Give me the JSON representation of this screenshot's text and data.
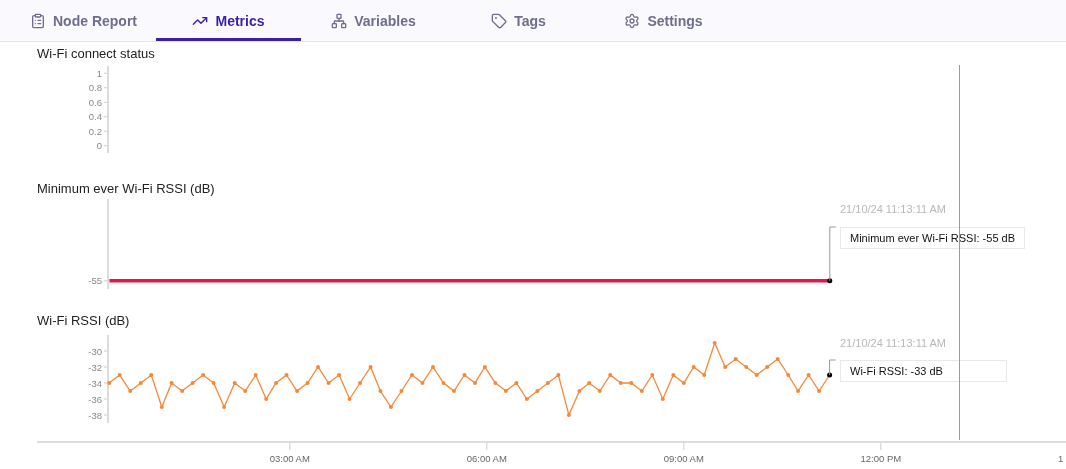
{
  "tabs": [
    {
      "label": "Node Report",
      "selected": false
    },
    {
      "label": "Metrics",
      "selected": true
    },
    {
      "label": "Variables",
      "selected": false
    },
    {
      "label": "Tags",
      "selected": false
    },
    {
      "label": "Settings",
      "selected": false
    }
  ],
  "charts": [
    {
      "title": "Wi-Fi connect status",
      "y_ticks": [
        "1",
        "0.8",
        "0.6",
        "0.4",
        "0.2",
        "0"
      ]
    },
    {
      "title": "Minimum ever Wi-Fi RSSI (dB)",
      "y_ticks": [
        "-55"
      ],
      "tooltip": {
        "time": "21/10/24 11:13:11 AM",
        "text": "Minimum ever Wi-Fi RSSI: -55 dB"
      }
    },
    {
      "title": "Wi-Fi RSSI (dB)",
      "chart_data": {
        "type": "line",
        "xlim": [
          -0.85,
          14.82
        ],
        "ylim": [
          -39,
          -28
        ],
        "yticks": [
          -38,
          -36,
          -34,
          -32,
          -30
        ],
        "xticks": [
          {
            "value": 3,
            "label": "03:00 AM"
          },
          {
            "value": 6,
            "label": "06:00 AM"
          },
          {
            "value": 9,
            "label": "09:00 AM"
          },
          {
            "value": 12,
            "label": "12:00 PM"
          }
        ],
        "x": [
          0.25,
          0.41,
          0.57,
          0.73,
          0.89,
          1.05,
          1.2,
          1.36,
          1.52,
          1.68,
          1.84,
          2.0,
          2.16,
          2.32,
          2.48,
          2.64,
          2.79,
          2.95,
          3.11,
          3.27,
          3.43,
          3.59,
          3.75,
          3.91,
          4.07,
          4.23,
          4.38,
          4.54,
          4.7,
          4.86,
          5.02,
          5.18,
          5.34,
          5.5,
          5.66,
          5.82,
          5.97,
          6.13,
          6.29,
          6.45,
          6.61,
          6.77,
          6.93,
          7.09,
          7.25,
          7.41,
          7.56,
          7.72,
          7.88,
          8.04,
          8.2,
          8.36,
          8.52,
          8.68,
          8.84,
          9.0,
          9.15,
          9.31,
          9.47,
          9.63,
          9.79,
          9.95,
          10.11,
          10.27,
          10.43,
          10.59,
          10.74,
          10.9,
          11.06,
          11.22
        ],
        "series": [
          {
            "color": "#f5893a",
            "values": [
              -34,
              -33,
              -35,
              -34,
              -33,
              -37,
              -34,
              -35,
              -34,
              -33,
              -34,
              -37,
              -34,
              -35,
              -33,
              -36,
              -34,
              -33,
              -35,
              -34,
              -32,
              -34,
              -33,
              -36,
              -34,
              -32,
              -35,
              -37,
              -35,
              -33,
              -34,
              -32,
              -34,
              -35,
              -33,
              -34,
              -32,
              -34,
              -35,
              -34,
              -36,
              -35,
              -34,
              -33,
              -38,
              -35,
              -34,
              -35,
              -33,
              -34,
              -34,
              -35,
              -33,
              -36,
              -33,
              -34,
              -32,
              -33,
              -29,
              -32,
              -31,
              -32,
              -33,
              -32,
              -31,
              -33,
              -35,
              -33,
              -35,
              -33
            ]
          }
        ]
      },
      "tooltip": {
        "time": "21/10/24 11:13:11 AM",
        "text": "Wi-Fi RSSI: -33 dB"
      },
      "edge_tick_label": "1"
    }
  ]
}
